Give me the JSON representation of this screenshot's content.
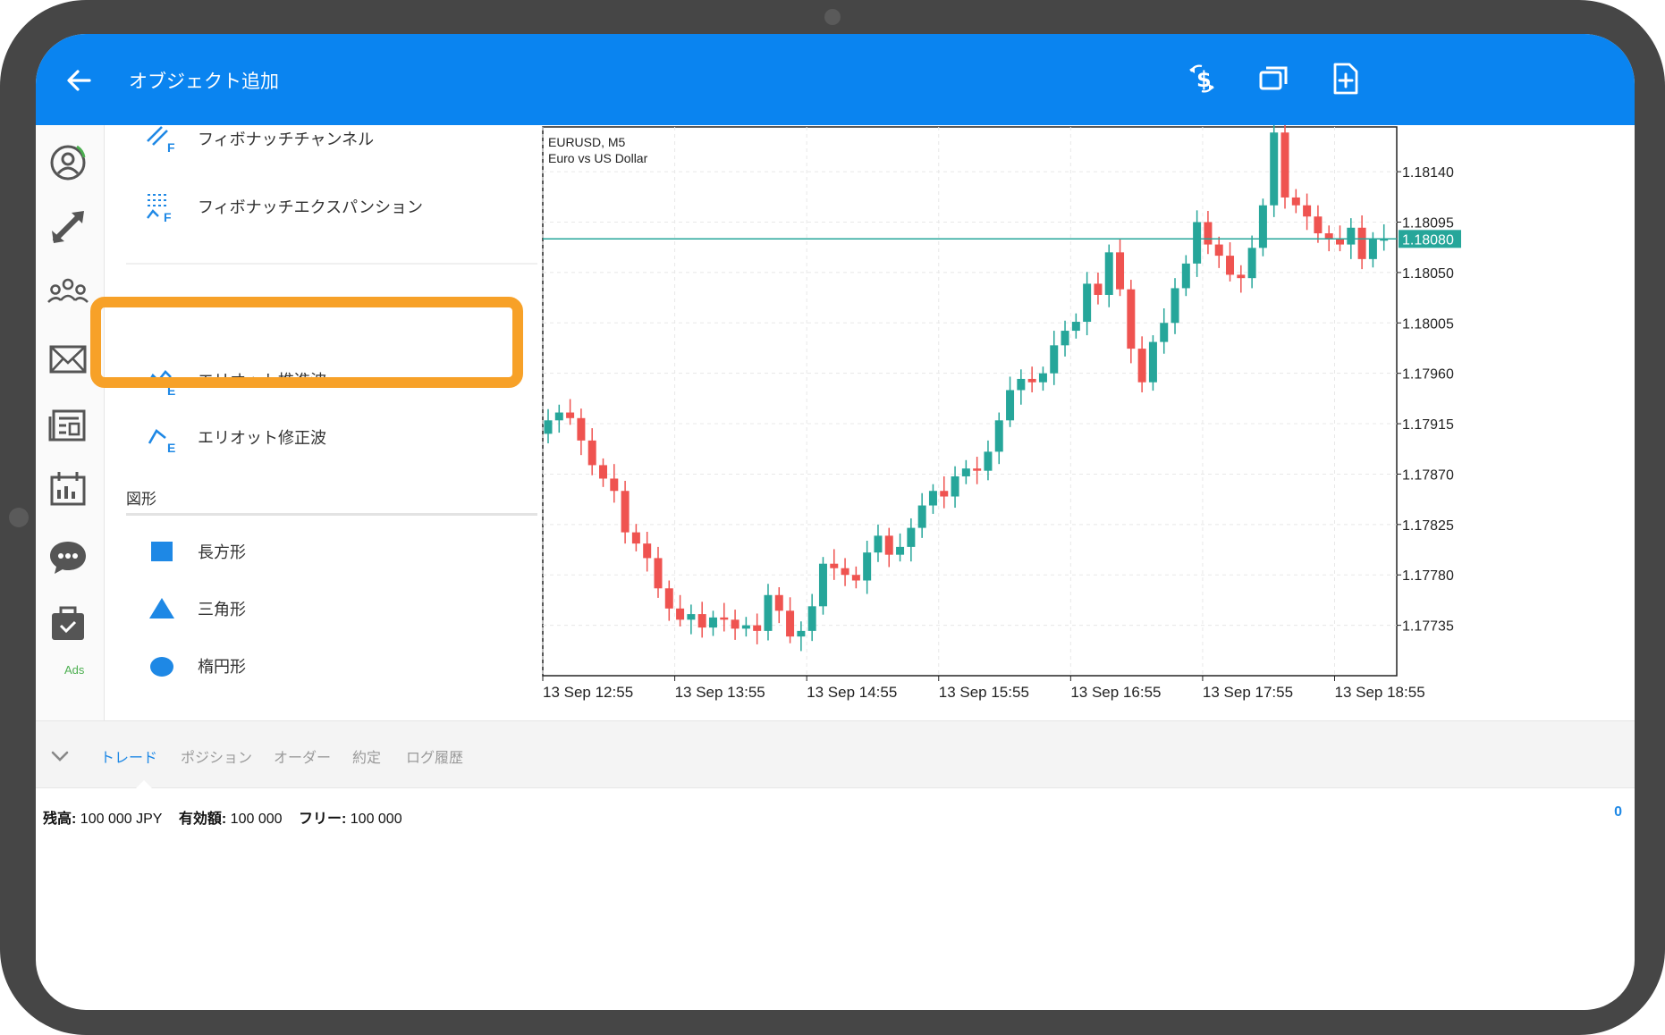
{
  "header": {
    "title": "オブジェクト追加"
  },
  "rail": {
    "ads_label": "Ads"
  },
  "objects": {
    "fib_channel": "フィボナッチチャンネル",
    "fib_expansion": "フィボナッチエクスパンション",
    "elliott_impulse": "エリオット推進波",
    "elliott_correction": "エリオット修正波",
    "shapes_header": "図形",
    "rectangle": "長方形",
    "triangle": "三角形",
    "ellipse": "楕円形"
  },
  "chart_data": {
    "type": "candlestick",
    "symbol": "EURUSD, M5",
    "description": "Euro vs US Dollar",
    "current_price": 1.1808,
    "y_ticks": [
      1.1814,
      1.18095,
      1.1805,
      1.18005,
      1.1796,
      1.17915,
      1.1787,
      1.17825,
      1.1778,
      1.17735
    ],
    "ylim": [
      1.1769,
      1.1818
    ],
    "x_ticks": [
      "13 Sep 12:55",
      "13 Sep 13:55",
      "13 Sep 14:55",
      "13 Sep 15:55",
      "13 Sep 16:55",
      "13 Sep 17:55",
      "13 Sep 18:55"
    ],
    "colors": {
      "up": "#26a69a",
      "down": "#ef5350",
      "price_line": "#26a69a"
    },
    "closes": [
      1.17918,
      1.17925,
      1.1792,
      1.179,
      1.17878,
      1.17866,
      1.17855,
      1.17818,
      1.17808,
      1.17795,
      1.17768,
      1.1775,
      1.1774,
      1.17745,
      1.17733,
      1.17742,
      1.1774,
      1.17732,
      1.17735,
      1.1773,
      1.17762,
      1.17748,
      1.17725,
      1.1773,
      1.17752,
      1.1779,
      1.17786,
      1.1778,
      1.17775,
      1.178,
      1.17815,
      1.17798,
      1.17805,
      1.17822,
      1.17842,
      1.17855,
      1.1785,
      1.17868,
      1.17875,
      1.17873,
      1.1789,
      1.17918,
      1.17945,
      1.17955,
      1.17952,
      1.1796,
      1.17985,
      1.17998,
      1.18006,
      1.1804,
      1.1803,
      1.18068,
      1.18035,
      1.17982,
      1.17952,
      1.17988,
      1.18005,
      1.18036,
      1.18058,
      1.18095,
      1.18075,
      1.18065,
      1.18048,
      1.18045,
      1.18072,
      1.1811,
      1.18175,
      1.18117,
      1.1811,
      1.181,
      1.18085,
      1.1808,
      1.18075,
      1.1809,
      1.18062,
      1.1808,
      1.1808
    ]
  },
  "bottom_tabs": {
    "trade": "トレード",
    "positions": "ポジション",
    "orders": "オーダー",
    "deals": "約定",
    "log": "ログ履歴"
  },
  "account": {
    "balance_label": "残高:",
    "balance_value": "100 000 JPY",
    "equity_label": "有効額:",
    "equity_value": "100 000",
    "free_label": "フリー:",
    "free_value": "100 000",
    "count": "0"
  }
}
